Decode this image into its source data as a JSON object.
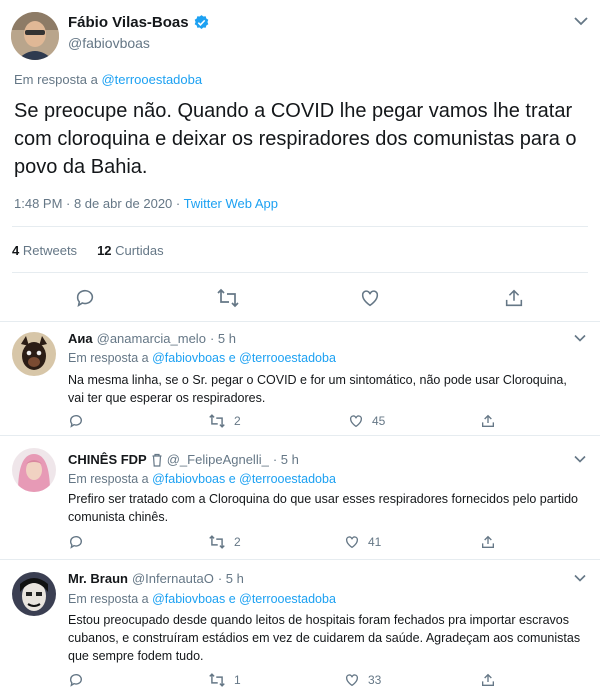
{
  "tweet": {
    "author_name": "Fábio Vilas-Boas",
    "author_handle": "@fabiovboas",
    "reply_to_prefix": "Em resposta a",
    "reply_to_handle": "@terrooestadoba",
    "text": "Se preocupe não. Quando a COVID lhe pegar vamos lhe tratar com cloroquina e deixar os respiradores dos comunistas para o povo da Bahia.",
    "timestamp": "1:48 PM · 8 de abr de 2020 · ",
    "source": "Twitter Web App",
    "retweets_count": "4",
    "retweets_label": "Retweets",
    "likes_count": "12",
    "likes_label": "Curtidas"
  },
  "replies": [
    {
      "name": "Аиа",
      "handle": "@anamarcia_melo",
      "time": "· 5 h",
      "reply_prefix": "Em resposta a",
      "reply_handles": "@fabiovboas e @terrooestadoba",
      "text": "Na mesma linha, se o Sr. pegar o COVID e for um sintomático, não pode usar Cloroquina, vai ter que esperar os respiradores.",
      "retweets": "2",
      "likes": "45"
    },
    {
      "name": "CHINÊS FDP",
      "handle": "@_FelipeAgnelli_",
      "time": "· 5 h",
      "reply_prefix": "Em resposta a",
      "reply_handles": "@fabiovboas e @terrooestadoba",
      "text": "Prefiro ser tratado com a Cloroquina do que usar esses respiradores fornecidos pelo partido comunista chinês.",
      "retweets": "2",
      "likes": "41"
    },
    {
      "name": "Mr. Braun",
      "handle": "@InfernautaO",
      "time": "· 5 h",
      "reply_prefix": "Em resposta a",
      "reply_handles": "@fabiovboas e @terrooestadoba",
      "text": "Estou preocupado desde quando leitos de hospitais foram fechados pra importar escravos cubanos, e construíram estádios em vez de cuidarem da saúde. Agradeçam aos comunistas que sempre fodem tudo.",
      "retweets": "1",
      "likes": "33"
    }
  ],
  "colors": {
    "accent": "#1da1f2",
    "muted": "#657786",
    "text": "#14171a",
    "border": "#e6ecf0"
  },
  "icons": [
    "reply-icon",
    "retweet-icon",
    "like-icon",
    "share-icon",
    "verified-icon",
    "chevron-down-icon",
    "trash-icon"
  ]
}
